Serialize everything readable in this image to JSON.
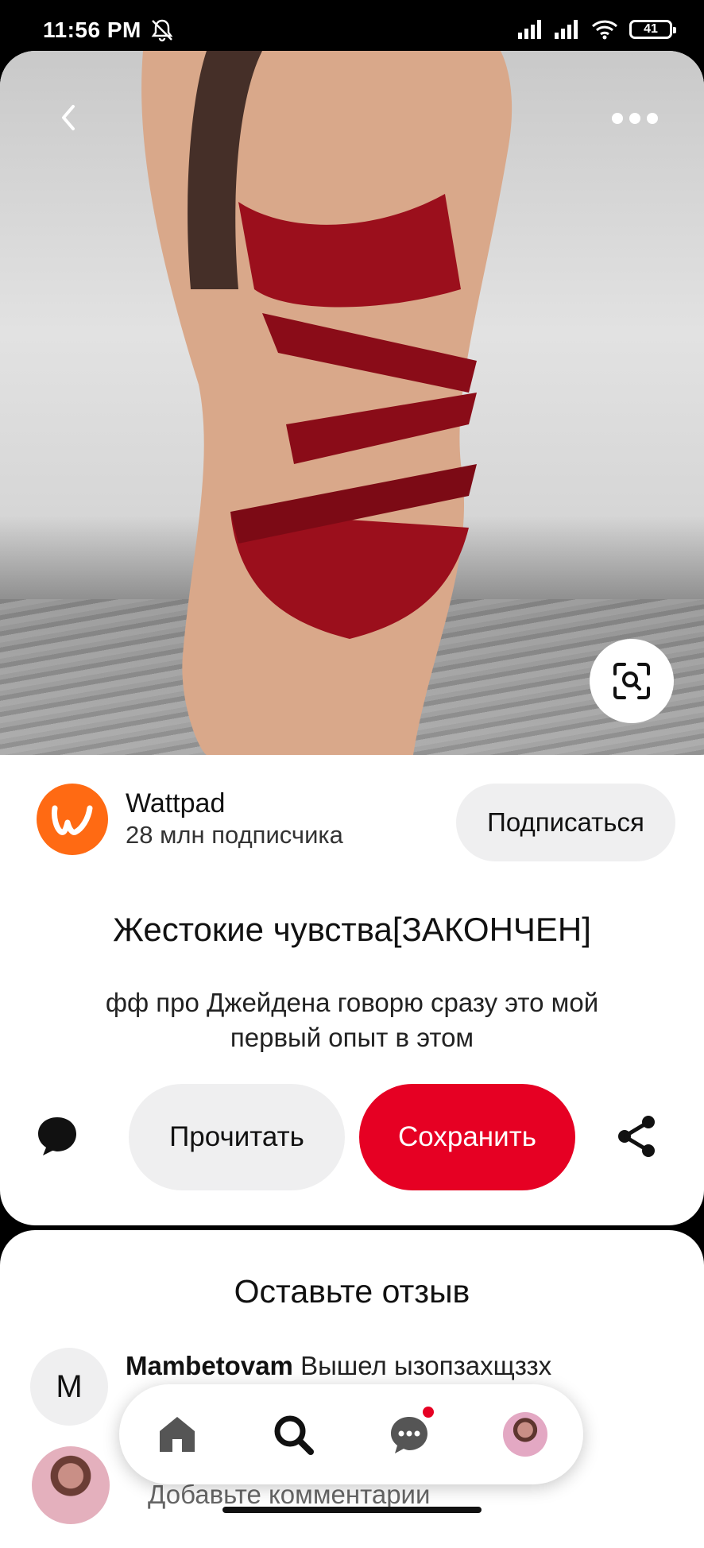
{
  "status_bar": {
    "time": "11:56 PM",
    "battery": "41",
    "icons": [
      "bell-off-icon",
      "signal-icon",
      "signal-icon",
      "wifi-icon",
      "battery-icon"
    ]
  },
  "pin": {
    "image_icons": [
      "back-icon",
      "more-icon",
      "visual-search-icon"
    ],
    "creator": {
      "name": "Wattpad",
      "subscribers": "28 млн подписчика",
      "follow_label": "Подписаться"
    },
    "title": "Жестокие чувства[ЗАКОНЧЕН]",
    "description": "фф про Джейдена говорю сразу это мой первый опыт в этом",
    "actions": {
      "read_label": "Прочитать",
      "save_label": "Сохранить"
    }
  },
  "reviews": {
    "title": "Оставьте отзыв",
    "items": [
      {
        "avatar_letter": "M",
        "user": "Mambetovam",
        "text": "Вышел ызопзахщззх"
      }
    ],
    "input_placeholder": "Добавьте комментарии"
  },
  "bottom_nav": {
    "items": [
      "home-icon",
      "search-icon",
      "messages-icon",
      "profile-avatar"
    ],
    "messages_has_notification": true
  },
  "colors": {
    "accent": "#e60023",
    "wattpad": "#ff6a13",
    "button_gray": "#efeff0"
  }
}
